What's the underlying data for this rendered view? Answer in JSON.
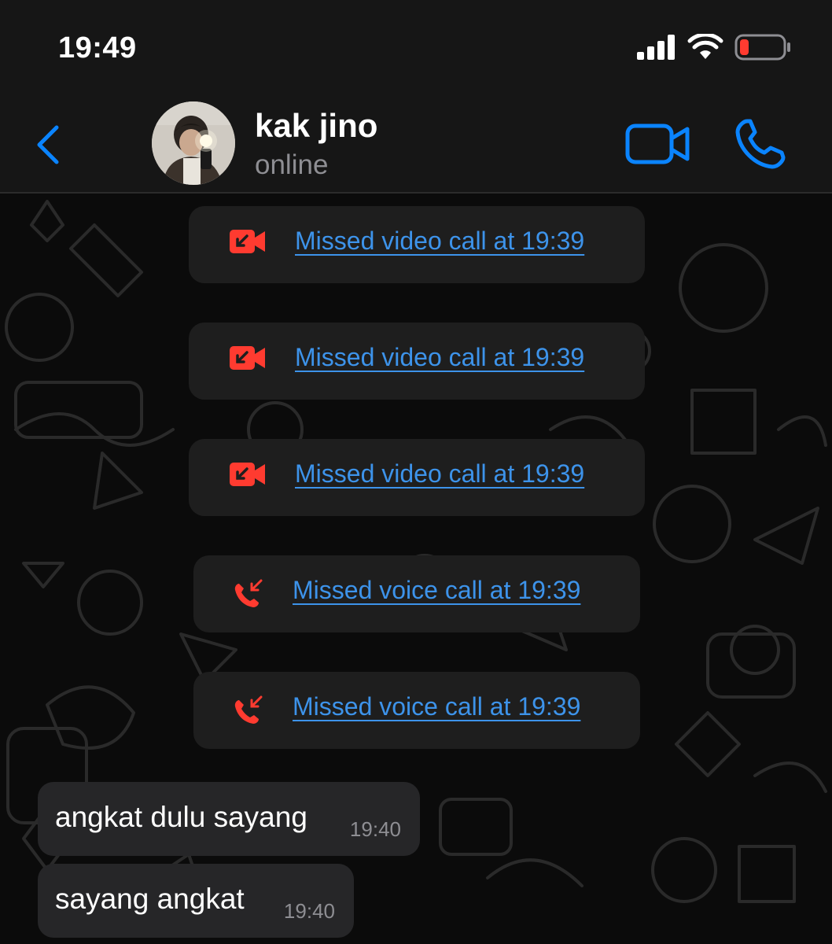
{
  "status_bar": {
    "time": "19:49",
    "icons": [
      "signal-icon",
      "wifi-icon",
      "battery-low-icon"
    ],
    "battery_color": "#ff3b30"
  },
  "header": {
    "back_icon": "chevron-left-icon",
    "contact_name": "kak jino",
    "contact_status": "online",
    "video_icon": "video-camera-icon",
    "phone_icon": "phone-icon",
    "accent_color": "#0a84ff"
  },
  "calls": [
    {
      "type": "video",
      "icon": "missed-video-call-icon",
      "text": "Missed video call at 19:39"
    },
    {
      "type": "video",
      "icon": "missed-video-call-icon",
      "text": "Missed video call at 19:39"
    },
    {
      "type": "video",
      "icon": "missed-video-call-icon",
      "text": "Missed video call at 19:39"
    },
    {
      "type": "voice",
      "icon": "missed-voice-call-icon",
      "text": "Missed voice call at 19:39"
    },
    {
      "type": "voice",
      "icon": "missed-voice-call-icon",
      "text": "Missed voice call at 19:39"
    }
  ],
  "missed_call_color": "#ff3b30",
  "link_color": "#3d93ea",
  "messages": [
    {
      "text": "angkat dulu sayang",
      "time": "19:40",
      "direction": "incoming"
    },
    {
      "text": "sayang angkat",
      "time": "19:40",
      "direction": "incoming"
    }
  ]
}
